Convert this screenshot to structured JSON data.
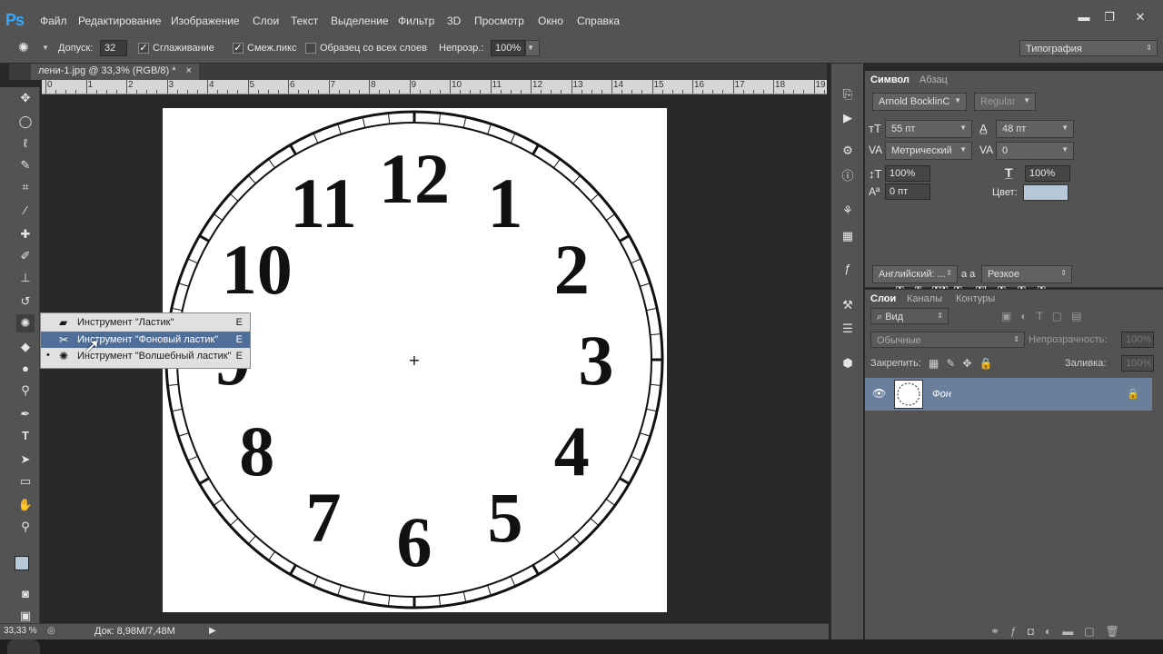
{
  "app": {
    "logo": "Ps"
  },
  "menu": [
    "Файл",
    "Редактирование",
    "Изображение",
    "Слои",
    "Текст",
    "Выделение",
    "Фильтр",
    "3D",
    "Просмотр",
    "Окно",
    "Справка"
  ],
  "window_controls": {
    "minimize": "▬",
    "restore": "❐",
    "close": "✕"
  },
  "options": {
    "tolerance_label": "Допуск:",
    "tolerance_value": "32",
    "antialias_label": "Сглаживание",
    "contiguous_label": "Смеж.пикс",
    "sample_all_label": "Образец со всех слоев",
    "opacity_label": "Непрозр.:",
    "opacity_value": "100%",
    "workspace": "Типография"
  },
  "document": {
    "tab_title": "лени-1.jpg @ 33,3% (RGB/8) *",
    "tab_close": "×",
    "doc_info": "Док: 8,98M/7,48M",
    "zoom": "33,33 %"
  },
  "ruler": {
    "labels": [
      "0",
      "1",
      "2",
      "3",
      "4",
      "5",
      "6",
      "7",
      "8",
      "9",
      "10",
      "11",
      "12",
      "13",
      "14",
      "15",
      "16",
      "17",
      "18",
      "19"
    ]
  },
  "clock": {
    "numerals": [
      "12",
      "1",
      "2",
      "3",
      "4",
      "5",
      "6",
      "7",
      "8",
      "9",
      "10",
      "11"
    ]
  },
  "flyout": {
    "items": [
      {
        "label": "Инструмент \"Ластик\"",
        "key": "E",
        "icon": "eraser-icon"
      },
      {
        "label": "Инструмент \"Фоновый ластик\"",
        "key": "E",
        "icon": "background-eraser-icon"
      },
      {
        "label": "Инструмент \"Волшебный ластик\"",
        "key": "E",
        "icon": "magic-eraser-icon"
      }
    ]
  },
  "character": {
    "tab_active": "Символ",
    "tab_inactive": "Абзац",
    "font_family": "Arnold BocklinC",
    "font_style": "Regular",
    "font_size": "55 пт",
    "leading": "48 пт",
    "kerning": "Метрический",
    "tracking": "0",
    "vertical_scale": "100%",
    "horizontal_scale": "100%",
    "baseline_shift": "0 пт",
    "color_label": "Цвет:",
    "color_swatch": "#b7c9d8",
    "language": "Английский: ...",
    "antialias_method": "Резкое",
    "aa_label": "a a"
  },
  "layers": {
    "tabs": [
      "Слои",
      "Каналы",
      "Контуры"
    ],
    "filter_kind": "Вид",
    "blend_mode": "Обычные",
    "opacity_label": "Непрозрачность:",
    "opacity_value": "100%",
    "lock_label": "Закрепить:",
    "fill_label": "Заливка:",
    "fill_value": "100%",
    "layer_name": "Фон"
  },
  "colors": {
    "accent": "#31a8ff",
    "panel": "#535353",
    "selected_layer": "#6a7f9c"
  }
}
